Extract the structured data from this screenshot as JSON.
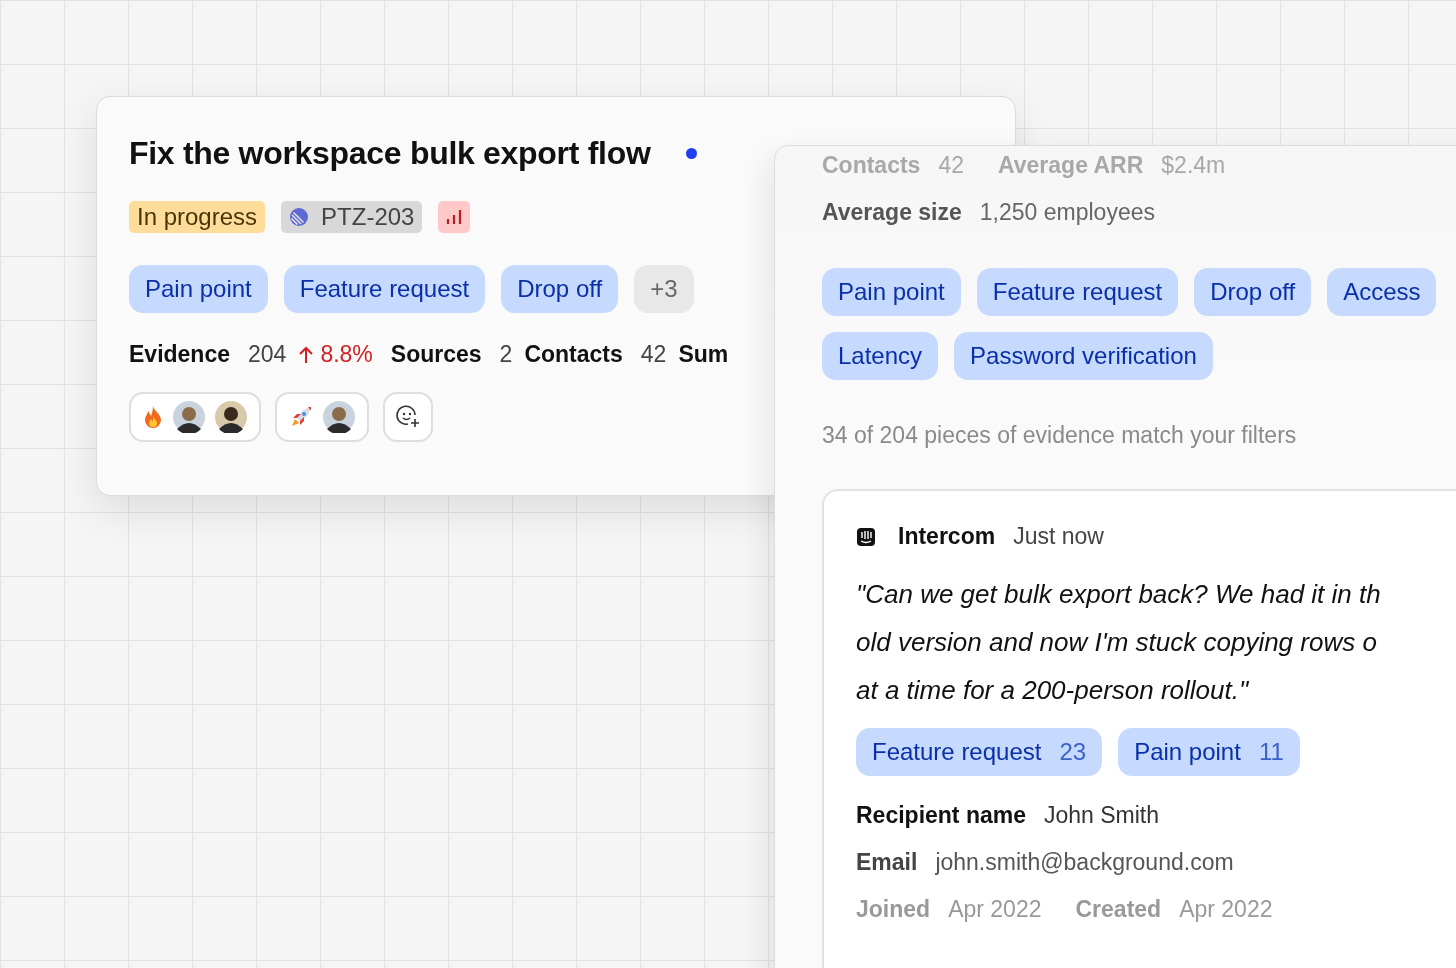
{
  "issue_card": {
    "title": "Fix the workspace bulk export flow",
    "unread": true,
    "badges": [
      {
        "kind": "status",
        "label": "In progress"
      },
      {
        "kind": "ticket",
        "label": "PTZ-203"
      },
      {
        "kind": "priority"
      }
    ],
    "tags": [
      {
        "kind": "tag",
        "label": "Pain point"
      },
      {
        "kind": "tag",
        "label": "Feature request"
      },
      {
        "kind": "tag",
        "label": "Drop off"
      },
      {
        "kind": "more",
        "label": "+3"
      }
    ],
    "metrics": [
      {
        "label": "Evidence",
        "value": "204",
        "trend": "8.8%"
      },
      {
        "label": "Sources",
        "value": "2"
      },
      {
        "label": "Contacts",
        "value": "42"
      },
      {
        "label": "Sum"
      }
    ],
    "reactions": [
      {
        "kind": "fire",
        "avatars": [
          {
            "kind": "light"
          },
          {
            "kind": "dark"
          }
        ]
      },
      {
        "kind": "rocket",
        "avatars": [
          {
            "kind": "light"
          }
        ]
      },
      {
        "kind": "add"
      }
    ]
  },
  "detail_panel": {
    "faded_stats": [
      {
        "label": "Contacts",
        "value": "42"
      },
      {
        "label": "Average ARR",
        "value": "$2.4m"
      }
    ],
    "stats": [
      {
        "label": "Average size",
        "value": "1,250 employees"
      }
    ],
    "tags": [
      "Pain point",
      "Feature request",
      "Drop off",
      "Access",
      "Latency",
      "Password verification"
    ],
    "filter_summary": "34 of 204 pieces of evidence match your filters",
    "evidence": {
      "source": "Intercom",
      "time": "Just now",
      "quote": [
        "\"Can we get bulk export back? We had it in th",
        "old version and now I'm stuck copying rows o",
        "at a time for a 200-person rollout.\""
      ],
      "tags": [
        {
          "label": "Feature request",
          "count": "23"
        },
        {
          "label": "Pain point",
          "count": "11"
        }
      ],
      "fields": [
        {
          "label": "Recipient name",
          "value": "John Smith",
          "kind": "primary"
        },
        {
          "label": "Email",
          "value": "john.smith@background.com",
          "kind": "secondary"
        }
      ],
      "faded_fields": [
        {
          "label": "Joined",
          "value": "Apr 2022"
        },
        {
          "label": "Created",
          "value": "Apr 2022"
        }
      ]
    }
  }
}
